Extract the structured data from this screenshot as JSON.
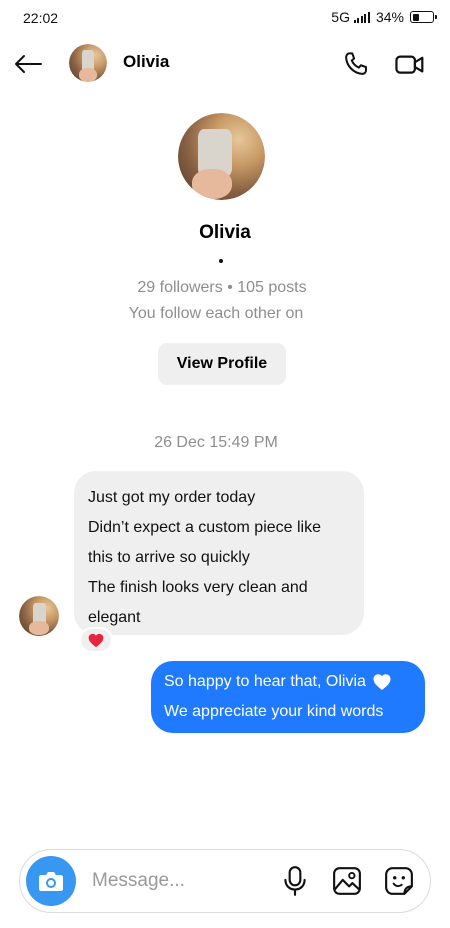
{
  "status_bar": {
    "time": "22:02",
    "network": "5G",
    "battery": "34%",
    "battery_level": 0.34
  },
  "header": {
    "contact_name": "Olivia"
  },
  "profile": {
    "name": "Olivia",
    "stats": "29 followers • 105 posts",
    "mutual": "You follow each other on",
    "view_profile_label": "View Profile"
  },
  "conversation": {
    "timestamp": "26 Dec 15:49 PM",
    "incoming": {
      "lines": [
        "Just got my order today",
        "Didn’t expect a custom piece like",
        "this to arrive so quickly",
        "The finish looks very clean and",
        "elegant"
      ],
      "reaction": "red-heart"
    },
    "outgoing": {
      "lines": [
        "So happy to hear that, Olivia",
        "We appreciate your kind words"
      ],
      "inline_icon": "white-heart-emoji"
    }
  },
  "composer": {
    "placeholder": "Message..."
  },
  "colors": {
    "outgoing_bubble": "#1f7aff",
    "incoming_bubble": "#efefef",
    "camera_button": "#3897f0",
    "muted_text": "#8e8e8e",
    "reaction_heart": "#e8253c"
  },
  "icons": [
    "back-arrow-icon",
    "phone-icon",
    "video-camera-icon",
    "camera-icon",
    "microphone-icon",
    "gallery-icon",
    "sticker-icon",
    "heart-icon",
    "signal-icon",
    "battery-icon"
  ]
}
